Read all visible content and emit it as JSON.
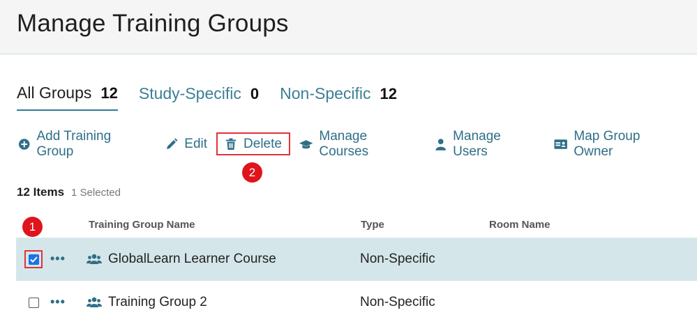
{
  "page": {
    "title": "Manage Training Groups"
  },
  "tabs": [
    {
      "label": "All Groups",
      "count": "12",
      "active": true
    },
    {
      "label": "Study-Specific",
      "count": "0",
      "active": false
    },
    {
      "label": "Non-Specific",
      "count": "12",
      "active": false
    }
  ],
  "toolbar": {
    "add_label": "Add Training Group",
    "edit_label": "Edit",
    "delete_label": "Delete",
    "manage_courses_label": "Manage Courses",
    "manage_users_label": "Manage Users",
    "map_owner_label": "Map Group Owner"
  },
  "callouts": {
    "one": "1",
    "two": "2"
  },
  "list": {
    "items_label": "12 Items",
    "selected_label": "1 Selected",
    "columns": [
      "Training Group Name",
      "Type",
      "Room Name"
    ],
    "rows": [
      {
        "name": "GlobalLearn Learner Course",
        "type": "Non-Specific",
        "room": "",
        "checked": true
      },
      {
        "name": "Training Group 2",
        "type": "Non-Specific",
        "room": "",
        "checked": false
      }
    ]
  },
  "colors": {
    "accent": "#2f6f87",
    "highlight": "#d5e6ea",
    "callout": "#e0141d",
    "checkbox": "#1a73e8"
  },
  "icons": [
    "plus-circle-icon",
    "pencil-icon",
    "trash-icon",
    "graduation-cap-icon",
    "user-icon",
    "id-card-icon",
    "more-icon",
    "users-icon"
  ]
}
